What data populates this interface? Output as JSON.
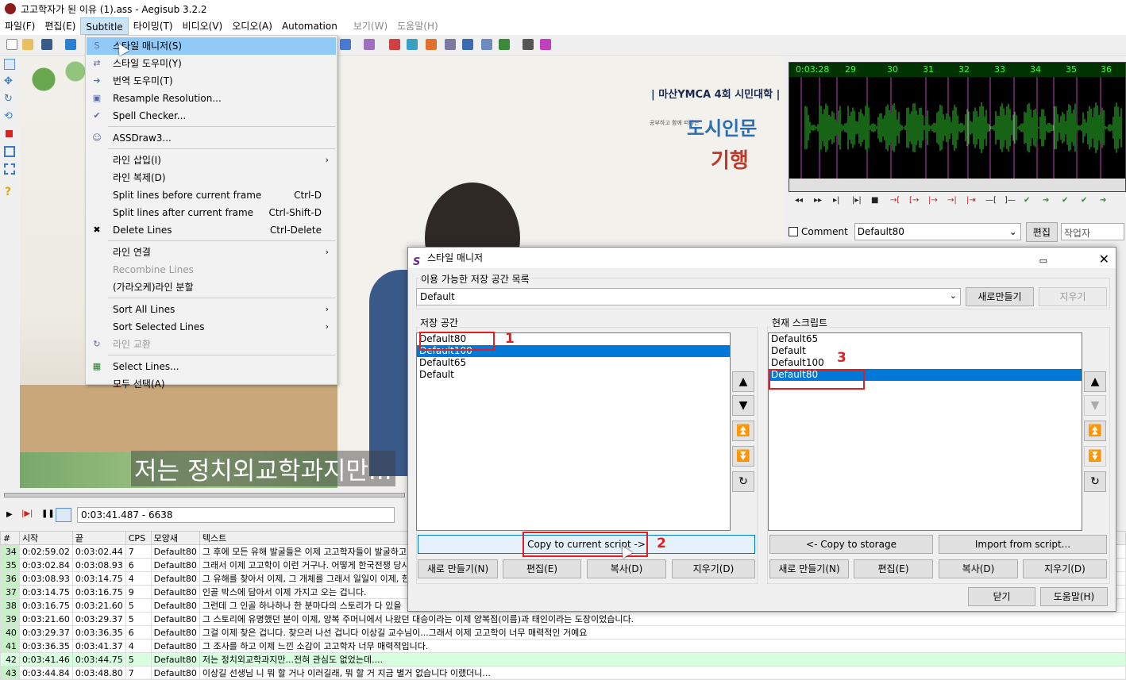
{
  "window": {
    "title": "고고학자가 된 이유 (1).ass - Aegisub 3.2.2"
  },
  "menubar": [
    "파일(F)",
    "편집(E)",
    "Subtitle",
    "타이밍(T)",
    "비디오(V)",
    "오디오(A)",
    "Automation",
    "보기(W)",
    "도움말(H)"
  ],
  "subtitle_menu": {
    "items": [
      {
        "icon": "style-manager-icon",
        "glyph": "S",
        "label": "스타일 매니저(S)",
        "shortcut": "",
        "hover": true
      },
      {
        "icon": "style-assistant-icon",
        "glyph": "⇄",
        "label": "스타일 도우미(Y)",
        "shortcut": ""
      },
      {
        "icon": "translation-assistant-icon",
        "glyph": "➔",
        "label": "번역 도우미(T)",
        "shortcut": ""
      },
      {
        "icon": "resample-icon",
        "glyph": "▣",
        "label": "Resample Resolution...",
        "shortcut": ""
      },
      {
        "icon": "spell-checker-icon",
        "glyph": "✔",
        "label": "Spell Checker...",
        "shortcut": ""
      },
      {
        "icon": "assdraw-icon",
        "glyph": "☺",
        "label": "ASSDraw3...",
        "shortcut": ""
      },
      {
        "icon": "",
        "glyph": "",
        "label": "라인 삽입(I)",
        "shortcut": "",
        "submenu": true
      },
      {
        "icon": "",
        "glyph": "",
        "label": "라인 복제(D)",
        "shortcut": ""
      },
      {
        "icon": "",
        "glyph": "",
        "label": "Split lines before current frame",
        "shortcut": "Ctrl-D"
      },
      {
        "icon": "",
        "glyph": "",
        "label": "Split lines after current frame",
        "shortcut": "Ctrl-Shift-D"
      },
      {
        "icon": "delete-icon",
        "glyph": "✖",
        "label": "Delete Lines",
        "shortcut": "Ctrl-Delete"
      },
      {
        "icon": "",
        "glyph": "",
        "label": "라인 연결",
        "shortcut": "",
        "submenu": true
      },
      {
        "icon": "",
        "glyph": "",
        "label": "Recombine Lines",
        "shortcut": "",
        "disabled": true
      },
      {
        "icon": "",
        "glyph": "",
        "label": "(가라오케)라인 분할",
        "shortcut": ""
      },
      {
        "icon": "",
        "glyph": "",
        "label": "Sort All Lines",
        "shortcut": "",
        "submenu": true
      },
      {
        "icon": "",
        "glyph": "",
        "label": "Sort Selected Lines",
        "shortcut": "",
        "submenu": true
      },
      {
        "icon": "swap-icon",
        "glyph": "↻",
        "label": "라인 교환",
        "shortcut": "",
        "disabled": true
      },
      {
        "icon": "select-lines-icon",
        "glyph": "▦",
        "label": "Select Lines...",
        "shortcut": ""
      },
      {
        "icon": "",
        "glyph": "",
        "label": "모두 선택(A)",
        "shortcut": ""
      }
    ]
  },
  "video": {
    "subtitle_text": "저는 정치외교학과지만...",
    "sign_line1": "| 마산YMCA 4회 시민대학 |",
    "sign_small": "공부하고 함께 떠나는",
    "sign_line2": "도시인문",
    "sign_line3": "기행"
  },
  "audio": {
    "timeline_labels": [
      "0:03:28",
      "29",
      "30",
      "31",
      "32",
      "33",
      "34",
      "35",
      "36"
    ]
  },
  "edit_box": {
    "comment_label": "Comment",
    "style_value": "Default80",
    "edit_button": "편집",
    "actor_placeholder": "작업자"
  },
  "playback": {
    "timecode": "0:03:41.487 - 6638"
  },
  "grid": {
    "headers": [
      "#",
      "시작",
      "끝",
      "CPS",
      "모양새",
      "텍스트"
    ],
    "rows": [
      [
        "34",
        "0:02:59.02",
        "0:03:02.44",
        "7",
        "Default80",
        "그 후에 모든 유해 발굴들은 이제 고고학자들이 발굴하고"
      ],
      [
        "35",
        "0:03:02.84",
        "0:03:08.93",
        "6",
        "Default80",
        "그래서 이제 고고학이 이런 거구나. 어떻게 한국전쟁 당시"
      ],
      [
        "36",
        "0:03:08.93",
        "0:03:14.75",
        "4",
        "Default80",
        "그 유해를 찾아서 이제, 그 개체를 그래서 일일이 이제, 한"
      ],
      [
        "37",
        "0:03:14.75",
        "0:03:16.75",
        "9",
        "Default80",
        "인골 박스에 담아서 이제 가지고 오는 겁니다."
      ],
      [
        "38",
        "0:03:16.75",
        "0:03:21.60",
        "5",
        "Default80",
        "그런데 그 인골 하나하나 한 분마다의 스토리가 다 있을"
      ],
      [
        "39",
        "0:03:21.60",
        "0:03:29.37",
        "5",
        "Default80",
        "그 스토리에 유명했던 분이 이제, 양복 주머니에서 나왔던 대승이라는 이제 양복점(이름)과 태인이라는 도장이었습니다."
      ],
      [
        "40",
        "0:03:29.37",
        "0:03:36.35",
        "6",
        "Default80",
        "그걸 이제 찾은 겁니다. 찾으러 나선 겁니다 이상길 교수님이...그래서 이제 고고학이 너무 매력적인 거예요"
      ],
      [
        "41",
        "0:03:36.35",
        "0:03:41.37",
        "4",
        "Default80",
        "그 조사를 하고 이제 느낀 소감이 고고학자 너무 매력적입니다."
      ],
      [
        "42",
        "0:03:41.46",
        "0:03:44.75",
        "5",
        "Default80",
        "저는 정치외교학과지만...전혀 관심도 없었는데...."
      ],
      [
        "43",
        "0:03:44.84",
        "0:03:48.80",
        "7",
        "Default80",
        "이상길 선생님 니 뭐 할 거나 이러길래, 뭐 할 거 지금 별거 없습니다 이랬더니..."
      ]
    ]
  },
  "style_manager": {
    "title": "스타일 매니저",
    "storage_group_label": "이용 가능한 저장 공간 목록",
    "storage_combo_value": "Default",
    "new_storage_button": "새로만들기",
    "delete_storage_button": "지우기",
    "storage_list_label": "저장 공간",
    "storage_items": [
      "Default80",
      "Default100",
      "Default65",
      "Default"
    ],
    "storage_selected_index": 1,
    "current_list_label": "현재 스크립트",
    "current_items": [
      "Default65",
      "Default",
      "Default100",
      "Default80"
    ],
    "current_selected_index": 3,
    "copy_to_current_button": "Copy to current script ->",
    "copy_to_storage_button": "<- Copy to storage",
    "import_button": "Import from script...",
    "left_buttons": [
      "새로 만들기(N)",
      "편집(E)",
      "복사(D)",
      "지우기(D)"
    ],
    "right_buttons": [
      "새로 만들기(N)",
      "편집(E)",
      "복사(D)",
      "지우기(D)"
    ],
    "close_button": "닫기",
    "help_button": "도움말(H)",
    "annotations": [
      "1",
      "2",
      "3"
    ]
  }
}
